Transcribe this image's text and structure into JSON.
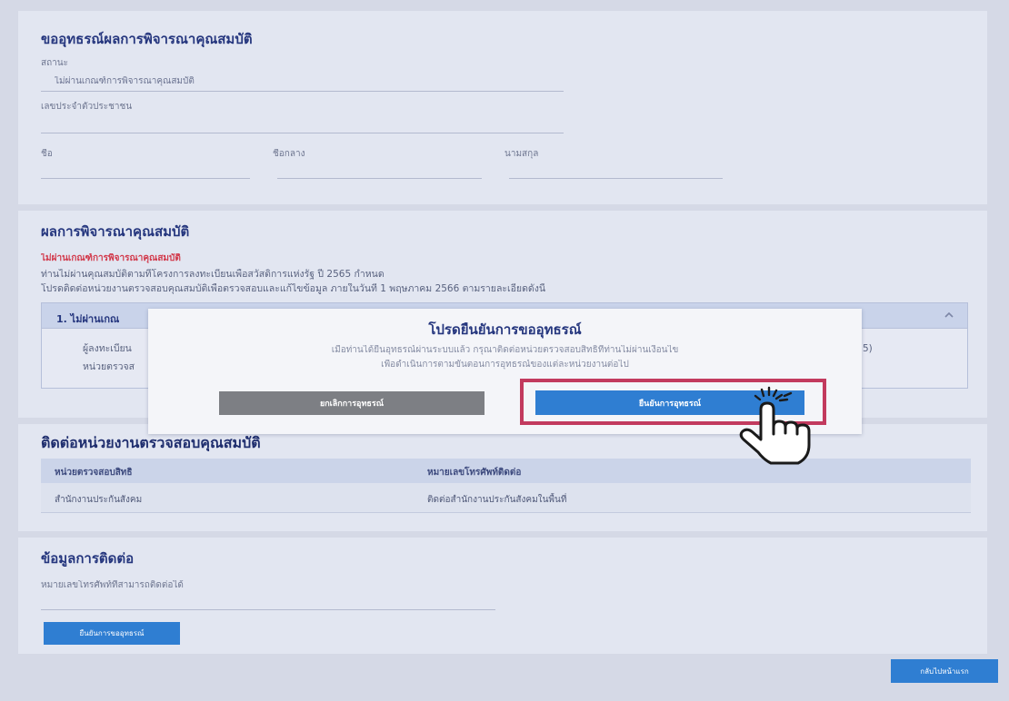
{
  "theme": {
    "page_bg": "#d5d9e6",
    "card_bg": "#e2e6f1",
    "title_color": "#25367e",
    "text_color": "#6e7690",
    "alert_red": "#d2394b",
    "primary_blue": "#2f7ed2",
    "cancel_gray": "#7d7f84",
    "highlight_red": "#c23a5e"
  },
  "icons": {
    "accordion_toggle": "chevron-up-icon",
    "pointer": "hand-pointer-icon",
    "click_effect": "click-sparkle-icon"
  },
  "appeal_form": {
    "title": "ขออุทธรณ์ผลการพิจารณาคุณสมบัติ",
    "status_label": "สถานะ",
    "status_value": "ไม่ผ่านเกณฑ์การพิจารณาคุณสมบัติ",
    "citizen_id_label": "เลขประจำตัวประชาชน",
    "first_name_label": "ชื่อ",
    "middle_name_label": "ชื่อกลาง",
    "last_name_label": "นามสกุล"
  },
  "result": {
    "title": "ผลการพิจารณาคุณสมบัติ",
    "status_text": "ไม่ผ่านเกณฑ์การพิจารณาคุณสมบัติ",
    "description": "ท่านไม่ผ่านคุณสมบัติตามที่โครงการลงทะเบียนเพื่อสวัสดิการแห่งรัฐ ปี 2565 กำหนด",
    "instruction": "โปรดติดต่อหน่วยงานตรวจสอบคุณสมบัติเพื่อตรวจสอบและแก้ไขข้อมูล ภายในวันที่ 1 พฤษภาคม 2566 ตามรายละเอียดดังนี้",
    "criteria": [
      {
        "header": "1. ไม่ผ่านเกณ",
        "line1": "ผู้ลงทะเบียน",
        "line2": "หน่วยตรวจส",
        "line1_tail": "5)"
      }
    ]
  },
  "confirm_modal": {
    "title": "โปรดยืนยันการขออุทธรณ์",
    "message_line1": "เมื่อท่านได้ยื่นอุทธรณ์ผ่านระบบแล้ว กรุณาติดต่อหน่วยตรวจสอบสิทธิ์ที่ท่านไม่ผ่านเงื่อนไข",
    "message_line2": "เพื่อดำเนินการตามขั้นตอนการอุทธรณ์ของแต่ละหน่วยงานต่อไป",
    "cancel_label": "ยกเลิกการอุทธรณ์",
    "confirm_label": "ยืนยันการอุทธรณ์"
  },
  "contact_agency": {
    "title": "ติดต่อหน่วยงานตรวจสอบคุณสมบัติ",
    "columns": [
      "หน่วยตรวจสอบสิทธิ",
      "หมายเลขโทรศัพท์ติดต่อ"
    ],
    "rows": [
      [
        "สำนักงานประกันสังคม",
        "ติดต่อสำนักงานประกันสังคมในพื้นที่"
      ]
    ]
  },
  "contact_info": {
    "title": "ข้อมูลการติดต่อ",
    "phone_label": "หมายเลขโทรศัพท์ที่สามารถติดต่อได้",
    "submit_label": "ยืนยันการขออุทธรณ์"
  },
  "footer": {
    "home_label": "กลับไปหน้าแรก"
  }
}
